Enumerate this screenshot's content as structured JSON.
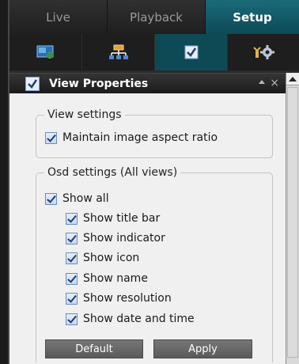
{
  "tabs": {
    "live": "Live",
    "playback": "Playback",
    "setup": "Setup",
    "active": "Setup"
  },
  "toolbar": {
    "icons": [
      "camera-settings-icon",
      "network-icon",
      "view-properties-icon",
      "system-settings-icon"
    ]
  },
  "panel": {
    "title": "View Properties",
    "collapse_icon": "collapse-up-icon",
    "close_icon": "×"
  },
  "view_settings": {
    "title": "View settings",
    "maintain_aspect_ratio": {
      "label": "Maintain image aspect ratio",
      "checked": true
    }
  },
  "osd_settings": {
    "title": "Osd settings (All views)",
    "show_all": {
      "label": "Show all",
      "checked": true
    },
    "options": [
      {
        "label": "Show title bar",
        "checked": true
      },
      {
        "label": "Show indicator",
        "checked": true
      },
      {
        "label": "Show icon",
        "checked": true
      },
      {
        "label": "Show name",
        "checked": true
      },
      {
        "label": "Show resolution",
        "checked": true
      },
      {
        "label": "Show date and time",
        "checked": true
      }
    ]
  },
  "buttons": {
    "default": "Default",
    "apply": "Apply"
  },
  "colors": {
    "accent": "#0d4a56",
    "panel_bg": "#f0f0f0",
    "dark_bg": "#1e1e1e"
  }
}
